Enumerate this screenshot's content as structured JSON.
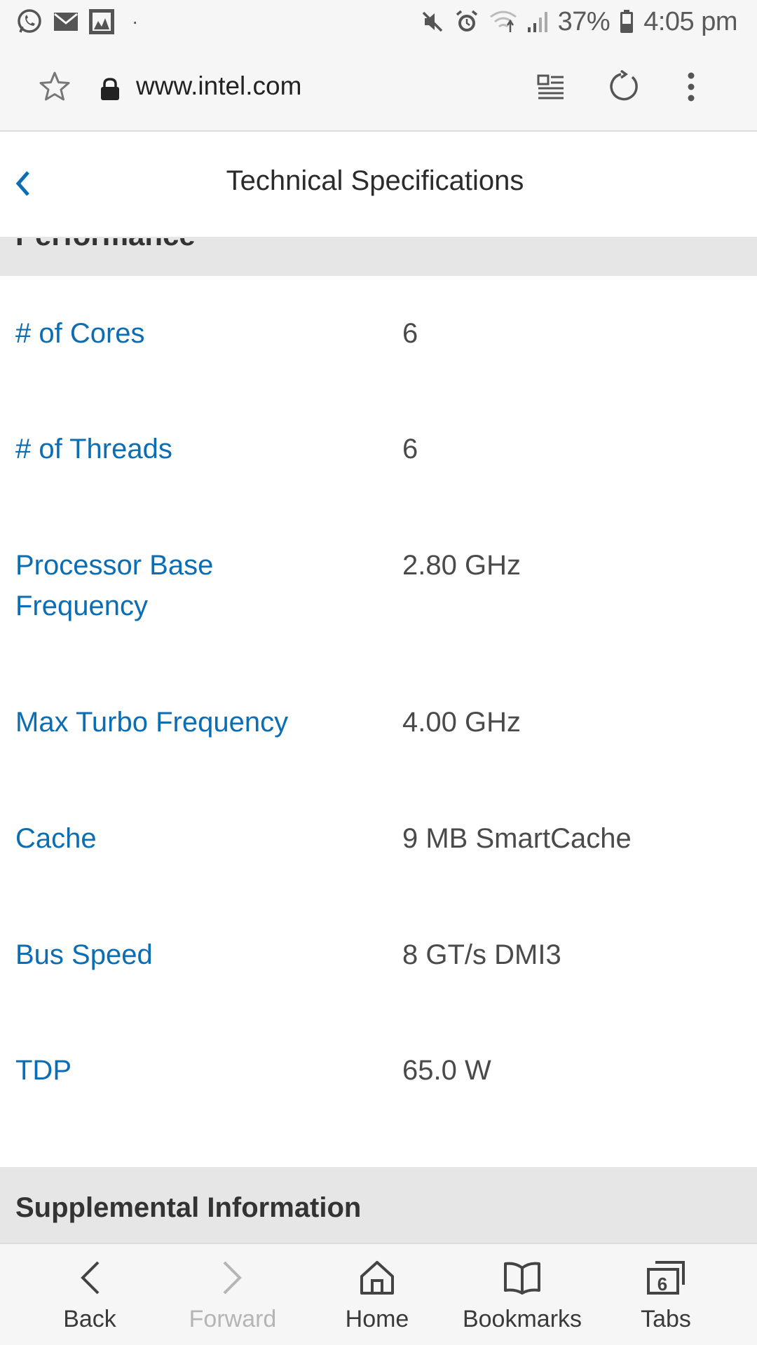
{
  "status_bar": {
    "battery_percent": "37%",
    "time": "4:05 pm",
    "dot": "·"
  },
  "browser": {
    "url": "www.intel.com"
  },
  "page": {
    "title": "Technical Specifications",
    "section_title": "Performance",
    "specs": [
      {
        "label": "# of Cores",
        "value": "6"
      },
      {
        "label": "# of Threads",
        "value": "6"
      },
      {
        "label": "Processor Base Frequency",
        "value": "2.80 GHz"
      },
      {
        "label": "Max Turbo Frequency",
        "value": "4.00 GHz"
      },
      {
        "label": "Cache",
        "value": "9 MB SmartCache"
      },
      {
        "label": "Bus Speed",
        "value": "8 GT/s DMI3"
      },
      {
        "label": "TDP",
        "value": "65.0 W"
      }
    ],
    "supplemental_title": "Supplemental Information"
  },
  "bottom_nav": {
    "back": "Back",
    "forward": "Forward",
    "home": "Home",
    "bookmarks": "Bookmarks",
    "tabs": "Tabs",
    "tab_count": "6"
  },
  "colors": {
    "link_blue": "#0b6db3",
    "banner_gray": "#e6e6e6"
  }
}
